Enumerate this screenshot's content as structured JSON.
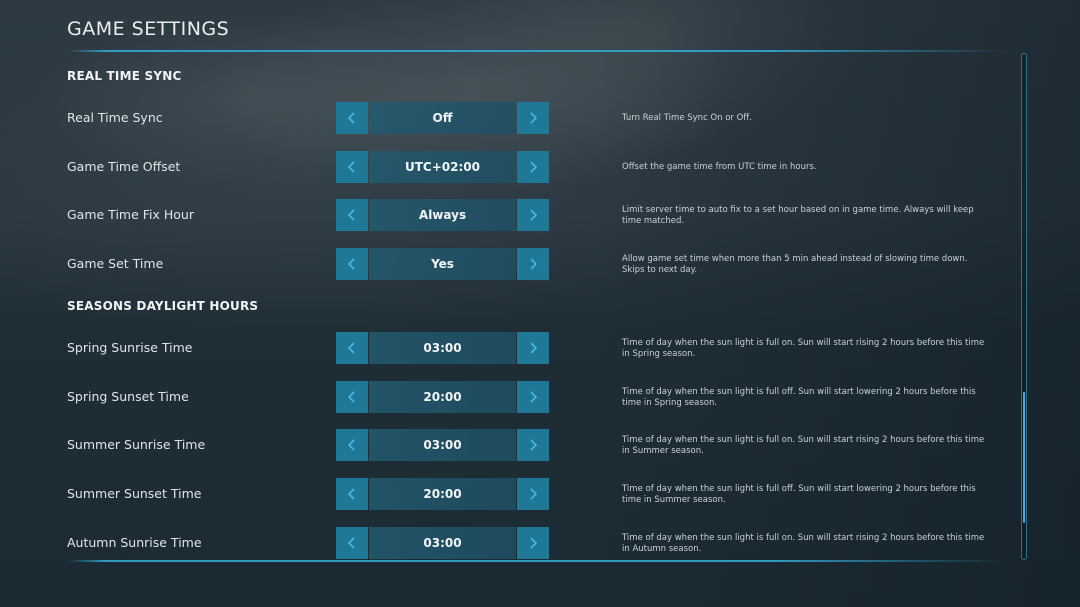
{
  "page": {
    "title": "GAME SETTINGS"
  },
  "sections": [
    {
      "title": "REAL TIME SYNC",
      "settings": [
        {
          "label": "Real Time Sync",
          "value": "Off",
          "description": "Turn Real Time Sync On or Off."
        },
        {
          "label": "Game Time Offset",
          "value": "UTC+02:00",
          "description": "Offset the game time from UTC time in hours."
        },
        {
          "label": "Game Time Fix Hour",
          "value": "Always",
          "description": "Limit server time to auto fix to a set hour based on in game time.  Always will keep time matched."
        },
        {
          "label": "Game Set Time",
          "value": "Yes",
          "description": "Allow game set time when more than 5 min ahead instead of slowing time down. Skips to next day."
        }
      ]
    },
    {
      "title": "SEASONS DAYLIGHT HOURS",
      "settings": [
        {
          "label": "Spring Sunrise Time",
          "value": "03:00",
          "description": "Time of day when the sun light is full on.  Sun will start rising 2 hours before this time in Spring season."
        },
        {
          "label": "Spring Sunset Time",
          "value": "20:00",
          "description": "Time of day when the sun light is full off.  Sun will start lowering 2 hours before this time in Spring season."
        },
        {
          "label": "Summer Sunrise Time",
          "value": "03:00",
          "description": "Time of day when the sun light is full on.  Sun will start rising 2 hours before this time in Summer season."
        },
        {
          "label": "Summer Sunset Time",
          "value": "20:00",
          "description": "Time of day when the sun light is full off.  Sun will start lowering 2 hours before this time in Summer season."
        },
        {
          "label": "Autumn Sunrise Time",
          "value": "03:00",
          "description": "Time of day when the sun light is full on.  Sun will start rising 2 hours before this time in Autumn season."
        }
      ]
    }
  ],
  "icons": {
    "prev": "chevron-left-icon",
    "next": "chevron-right-icon"
  },
  "scrollbar": {
    "thumb_start_fraction": 0.67,
    "thumb_end_fraction": 0.93
  },
  "colors": {
    "accent": "#32a0c8",
    "arrow_button": "#1f7896",
    "arrow_glyph": "#46b9e6",
    "value_box": "#23596f",
    "background": "#1e2b33"
  }
}
